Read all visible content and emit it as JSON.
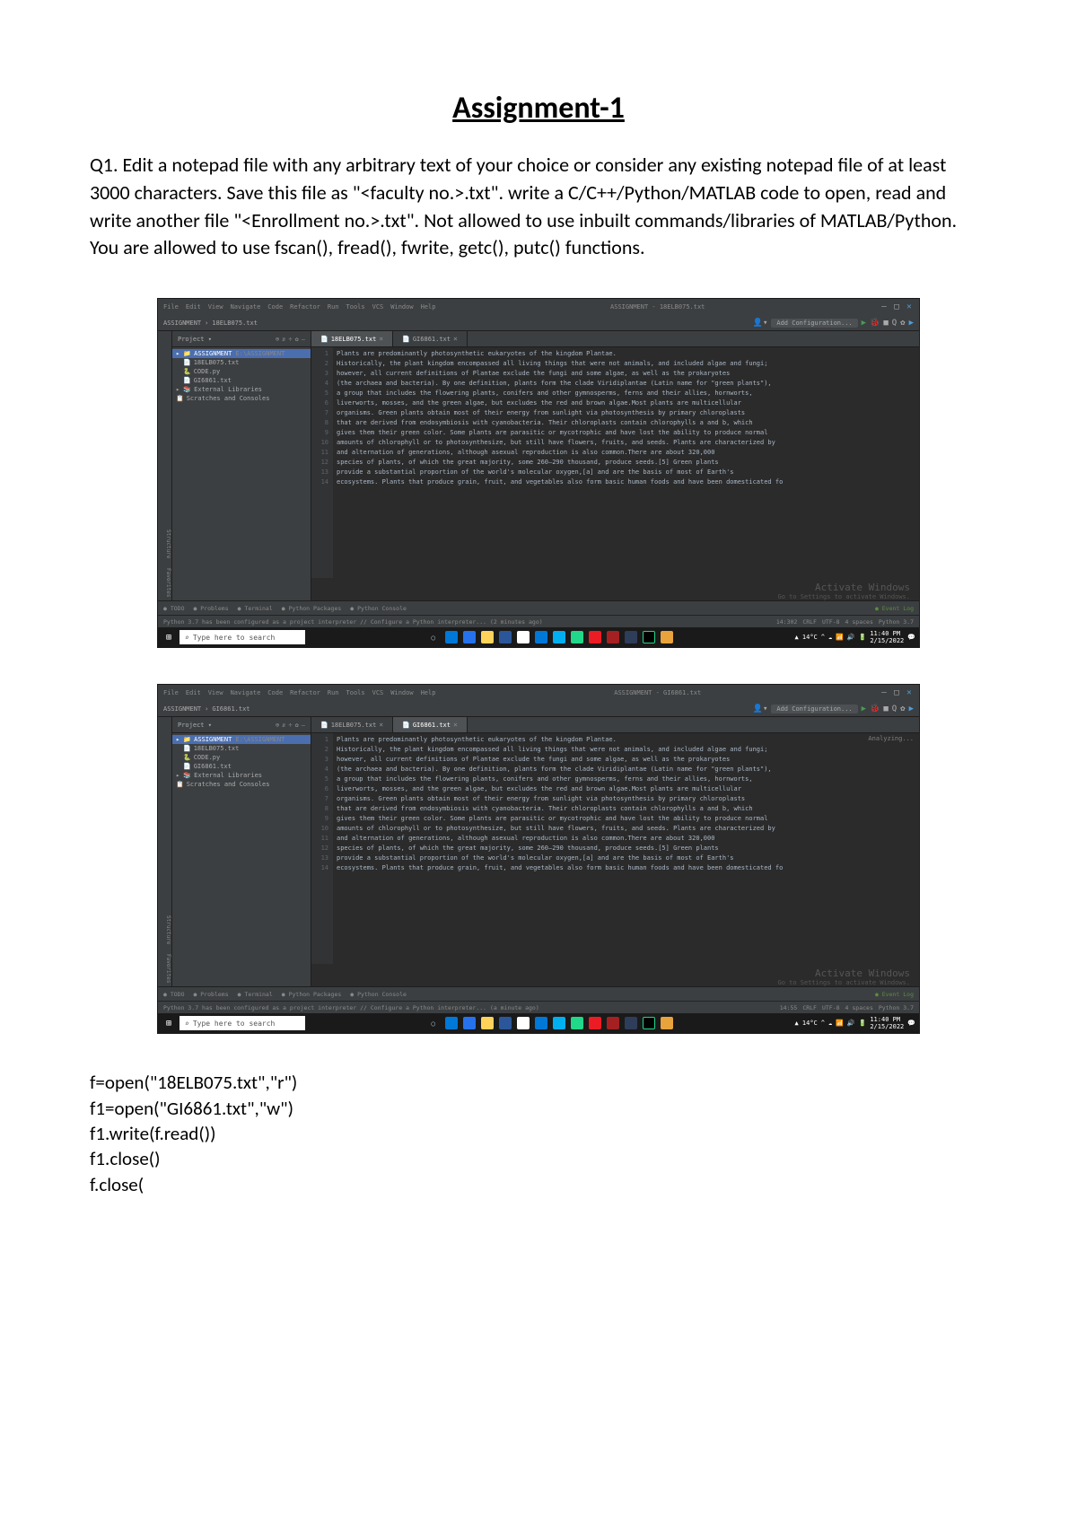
{
  "title": "Assignment-1",
  "question": "Q1. Edit a notepad file with any arbitrary text of your choice or consider any existing notepad file of at least 3000 characters. Save this file as \"<faculty no.>.txt\". write a C/C++/Python/MATLAB code to open, read and write another file \"<Enrollment no.>.txt\". Not allowed to use inbuilt commands/libraries of MATLAB/Python. You are allowed to use fscan(), fread(), fwrite, getc(), putc() functions.",
  "ide1": {
    "menubar": [
      "File",
      "Edit",
      "View",
      "Navigate",
      "Code",
      "Refactor",
      "Run",
      "Tools",
      "VCS",
      "Window",
      "Help"
    ],
    "title_suffix": "ASSIGNMENT - 18ELB075.txt",
    "breadcrumb": [
      "ASSIGNMENT",
      "18ELB075.txt"
    ],
    "add_config": "Add Configuration...",
    "project_label": "Project",
    "tree": [
      {
        "label": "ASSIGNMENT",
        "type": "folder",
        "path": "E:\\ASSIGNMENT",
        "indent": 0,
        "selected": true
      },
      {
        "label": "18ELB075.txt",
        "type": "txt",
        "indent": 1
      },
      {
        "label": "CODE.py",
        "type": "py",
        "indent": 1
      },
      {
        "label": "GI6861.txt",
        "type": "txt",
        "indent": 1
      },
      {
        "label": "External Libraries",
        "type": "lib",
        "indent": 0
      },
      {
        "label": "Scratches and Consoles",
        "type": "scratch",
        "indent": 0
      }
    ],
    "tabs": [
      {
        "label": "18ELB075.txt",
        "active": true
      },
      {
        "label": "GI6861.txt",
        "active": false
      }
    ],
    "lines": [
      "Plants are predominantly photosynthetic eukaryotes of the kingdom Plantae.",
      "Historically, the plant kingdom encompassed all living things that were not animals, and included algae and fungi;",
      "however, all current definitions of Plantae exclude the fungi and some algae, as well as the prokaryotes",
      "(the archaea and bacteria). By one definition, plants form the clade Viridiplantae (Latin name for \"green plants\"),",
      "a group that includes the flowering plants, conifers and other gymnosperms, ferns and their allies, hornworts,",
      "liverworts, mosses, and the green algae, but excludes the red and brown algae.Most plants are multicellular",
      "organisms. Green plants obtain most of their energy from sunlight via photosynthesis by primary chloroplasts",
      "that are derived from endosymbiosis with cyanobacteria. Their chloroplasts contain chlorophylls a and b, which",
      "gives them their green color. Some plants are parasitic or mycotrophic and have lost the ability to produce normal",
      "amounts of chlorophyll or to photosynthesize, but still have flowers, fruits, and seeds. Plants are characterized by",
      "and alternation of generations, although asexual reproduction is also common.There are about 320,000",
      "species of plants, of which the great majority, some 260–290 thousand, produce seeds.[5] Green plants",
      "provide a substantial proportion of the world's molecular oxygen,[a] and are the basis of most of Earth's",
      "ecosystems. Plants that produce grain, fruit, and vegetables also form basic human foods and have been domesticated fo"
    ],
    "watermark": "Activate Windows",
    "watermark_sub": "Go to Settings to activate Windows.",
    "bottom_tabs": [
      "TODO",
      "Problems",
      "Terminal",
      "Python Packages",
      "Python Console"
    ],
    "event_log": "Event Log",
    "status_msg": "Python 3.7 has been configured as a project interpreter // Configure a Python interpreter... (2 minutes ago)",
    "status_right": [
      "14:302",
      "CRLF",
      "UTF-8",
      "4 spaces",
      "Python 3.7"
    ],
    "taskbar": {
      "search": "Type here to search",
      "temp": "14°C",
      "time": "11:40 PM",
      "date": "2/15/2022"
    }
  },
  "ide2": {
    "title_suffix": "ASSIGNMENT - GI6861.txt",
    "breadcrumb": [
      "ASSIGNMENT",
      "GI6861.txt"
    ],
    "tabs": [
      {
        "label": "18ELB075.txt",
        "active": false
      },
      {
        "label": "GI6861.txt",
        "active": true
      }
    ],
    "analyzing": "Analyzing...",
    "status_msg": "Python 3.7 has been configured as a project interpreter // Configure a Python interpreter... (a minute ago)",
    "status_right": [
      "14:55",
      "CRLF",
      "UTF-8",
      "4 spaces",
      "Python 3.7"
    ],
    "taskbar": {
      "time": "11:40 PM",
      "date": "2/15/2022"
    }
  },
  "code_lines": [
    "f=open(\"18ELB075.txt\",\"r\")",
    "f1=open(\"GI6861.txt\",\"w\")",
    "f1.write(f.read())",
    "f1.close()",
    "f.close("
  ]
}
